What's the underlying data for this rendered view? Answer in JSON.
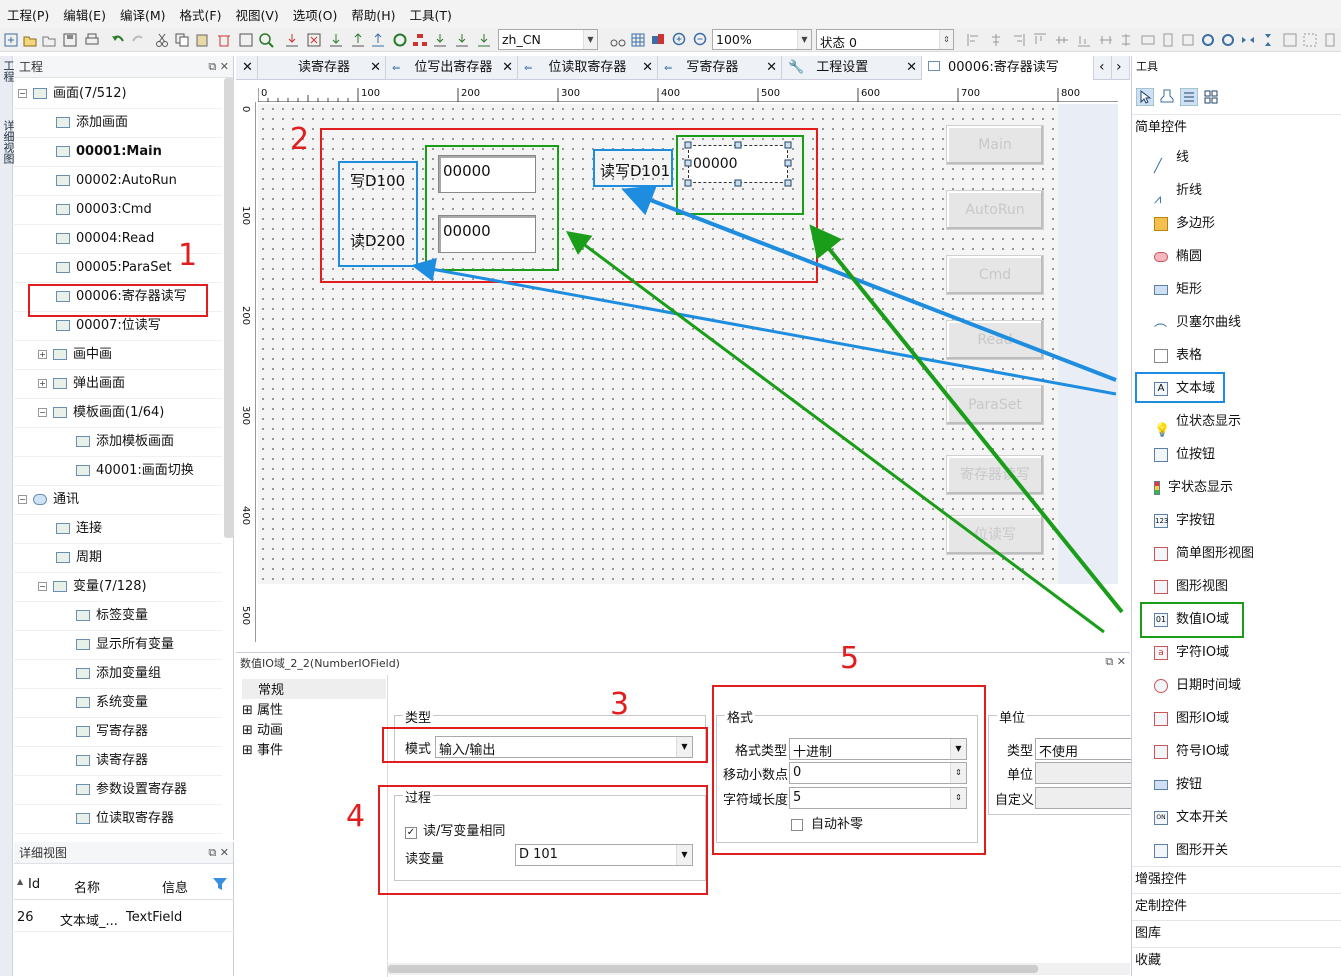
{
  "menu": [
    "工程(P)",
    "编辑(E)",
    "编译(M)",
    "格式(F)",
    "视图(V)",
    "选项(O)",
    "帮助(H)",
    "工具(T)"
  ],
  "toolbar": {
    "language": "zh_CN",
    "zoom": "100%",
    "state": "状态 0"
  },
  "left_strip": [
    "工程",
    "详细视图"
  ],
  "project": {
    "title": "工程",
    "rows": [
      "画面(7/512)",
      "添加画面",
      "00001:Main",
      "00002:AutoRun",
      "00003:Cmd",
      "00004:Read",
      "00005:ParaSet",
      "00006:寄存器读写",
      "00007:位读写",
      "画中画",
      "弹出画面",
      "模板画面(1/64)",
      "添加模板画面",
      "40001:画面切换",
      "通讯",
      "连接",
      "周期",
      "变量(7/128)",
      "标签变量",
      "显示所有变量",
      "添加变量组",
      "系统变量",
      "写寄存器",
      "读寄存器",
      "参数设置寄存器",
      "位读取寄存器"
    ]
  },
  "detail": {
    "title": "详细视图",
    "cols": [
      "Id",
      "名称",
      "信息"
    ],
    "row": [
      "26",
      "文本域_...",
      "TextField"
    ]
  },
  "tabs": [
    "读寄存器",
    "位写出寄存器",
    "位读取寄存器",
    "写寄存器",
    "工程设置",
    "00006:寄存器读写"
  ],
  "ruler_h": [
    "0",
    "100",
    "200",
    "300",
    "400",
    "500",
    "600",
    "700",
    "800"
  ],
  "ruler_v": [
    "0",
    "100",
    "200",
    "300",
    "400",
    "500"
  ],
  "design": {
    "write_label": "写D100",
    "read_label": "读D200",
    "rw_label": "读写D101",
    "field1": "00000",
    "field2": "00000",
    "field3": "00000",
    "nav": [
      "Main",
      "AutoRun",
      "Cmd",
      "Read",
      "ParaSet",
      "寄存器读写",
      "位读写"
    ]
  },
  "annotations": [
    "1",
    "2",
    "3",
    "4",
    "5"
  ],
  "props": {
    "title": "数值IO域_2_2(NumberIOField)",
    "nav": [
      "常规",
      "属性",
      "动画",
      "事件"
    ],
    "type_group": "类型",
    "mode_label": "模式",
    "mode_value": "输入/输出",
    "process_group": "过程",
    "same_var": "读/写变量相同",
    "read_var_label": "读变量",
    "read_var_value": "D 101",
    "format_group": "格式",
    "fmt_type_label": "格式类型",
    "fmt_type_value": "十进制",
    "decimal_label": "移动小数点",
    "decimal_value": "0",
    "len_label": "字符域长度",
    "len_value": "5",
    "zero_pad": "自动补零",
    "unit_group": "单位",
    "unit_type_label": "类型",
    "unit_type_value": "不使用",
    "unit_label": "单位",
    "custom_label": "自定义"
  },
  "tools": {
    "title": "工具",
    "section_simple": "简单控件",
    "items": [
      "线",
      "折线",
      "多边形",
      "椭圆",
      "矩形",
      "贝塞尔曲线",
      "表格",
      "文本域",
      "位状态显示",
      "位按钮",
      "字状态显示",
      "字按钮",
      "简单图形视图",
      "图形视图",
      "数值IO域",
      "字符IO域",
      "日期时间域",
      "图形IO域",
      "符号IO域",
      "按钮",
      "文本开关",
      "图形开关"
    ],
    "sections": [
      "增强控件",
      "定制控件",
      "图库",
      "收藏"
    ]
  },
  "colors": {
    "annotation_red": "#e11d1d",
    "annotation_green": "#1a9e1a",
    "annotation_blue": "#1e8de0"
  }
}
